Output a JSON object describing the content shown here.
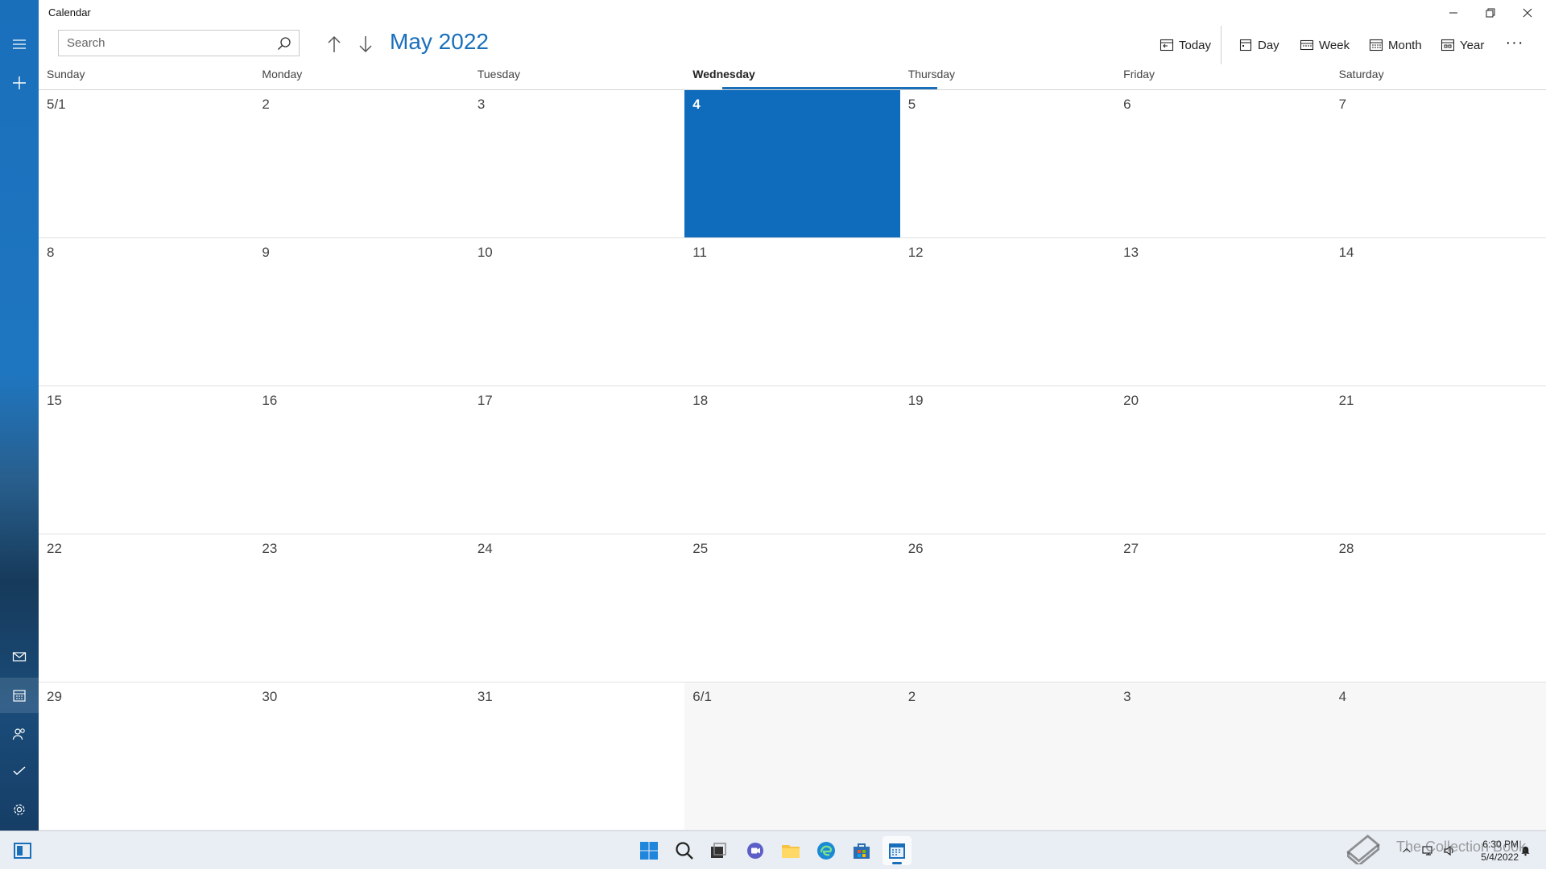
{
  "window": {
    "title": "Calendar"
  },
  "search": {
    "placeholder": "Search"
  },
  "header": {
    "month_title": "May 2022"
  },
  "toolbar": {
    "today_label": "Today",
    "day_label": "Day",
    "week_label": "Week",
    "month_label": "Month",
    "year_label": "Year",
    "more_label": "···"
  },
  "weekdays": [
    "Sunday",
    "Monday",
    "Tuesday",
    "Wednesday",
    "Thursday",
    "Friday",
    "Saturday"
  ],
  "today_weekday_index": 3,
  "weeks": [
    [
      "5/1",
      "2",
      "3",
      "4",
      "5",
      "6",
      "7"
    ],
    [
      "8",
      "9",
      "10",
      "11",
      "12",
      "13",
      "14"
    ],
    [
      "15",
      "16",
      "17",
      "18",
      "19",
      "20",
      "21"
    ],
    [
      "22",
      "23",
      "24",
      "25",
      "26",
      "27",
      "28"
    ],
    [
      "29",
      "30",
      "31",
      "6/1",
      "2",
      "3",
      "4"
    ]
  ],
  "today_cell": {
    "week": 0,
    "day": 3
  },
  "other_month_cells": [
    [
      4,
      3
    ],
    [
      4,
      4
    ],
    [
      4,
      5
    ],
    [
      4,
      6
    ]
  ],
  "taskbar": {
    "clock_time": "6:30 PM",
    "clock_date": "5/4/2022",
    "watermark": "The Collection Book"
  },
  "colors": {
    "accent": "#0f6cbd",
    "rail": "#1a6fbb",
    "other_month_bg": "#f7f7f7"
  }
}
